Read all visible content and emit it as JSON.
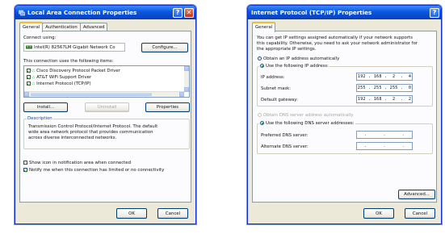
{
  "dialog1": {
    "title": "Local Area Connection Properties",
    "tabs": [
      "General",
      "Authentication",
      "Advanced"
    ],
    "connect_using_label": "Connect using:",
    "adapter_name": "Intel(R) 82567LM Gigabit Network Co",
    "configure_label": "Configure...",
    "items_label": "This connection uses the following items:",
    "items": [
      {
        "label": "Cisco Discovery Protocol Packet Driver",
        "checked": true
      },
      {
        "label": "AT&T WiFi Support Driver",
        "checked": true
      },
      {
        "label": "Internet Protocol (TCP/IP)",
        "checked": true
      }
    ],
    "install_label": "Install...",
    "uninstall_label": "Uninstall",
    "properties_label": "Properties",
    "description_label": "Description",
    "description_text_1": "Transmission Control Protocol/Internet Protocol. The default",
    "description_text_2": "wide area network protocol that provides communication",
    "description_text_3": "across diverse interconnected networks.",
    "show_icon_label": "Show icon in notification area when connected",
    "notify_label": "Notify me when this connection has limited or no connectivity",
    "ok_label": "OK",
    "cancel_label": "Cancel"
  },
  "dialog2": {
    "title": "Internet Protocol (TCP/IP) Properties",
    "tabs": [
      "General"
    ],
    "intro_1": "You can get IP settings assigned automatically if your network supports",
    "intro_2": "this capability. Otherwise, you need to ask your network administrator for",
    "intro_3": "the appropriate IP settings.",
    "obtain_ip_label": "Obtain an IP address automatically",
    "use_ip_label": "Use the following IP address:",
    "ip_label": "IP address:",
    "ip_value": "192 . 168 .  2  .  4",
    "subnet_label": "Subnet mask:",
    "subnet_value": "255 . 255 . 255 .  0",
    "gateway_label": "Default gateway:",
    "gateway_value": "192 . 168 .  2  .  2",
    "obtain_dns_label": "Obtain DNS server address automatically",
    "use_dns_label": "Use the following DNS server addresses:",
    "preferred_dns_label": "Preferred DNS server:",
    "preferred_dns_value": ".      .      .",
    "alternate_dns_label": "Alternate DNS server:",
    "alternate_dns_value": ".      .      .",
    "advanced_label": "Advanced...",
    "ok_label": "OK",
    "cancel_label": "Cancel"
  },
  "colors": {
    "titlebar": "#0a57e0",
    "dialog_bg": "#ece9d8",
    "close_button": "#c1381a",
    "check_mark": "#21a121"
  }
}
